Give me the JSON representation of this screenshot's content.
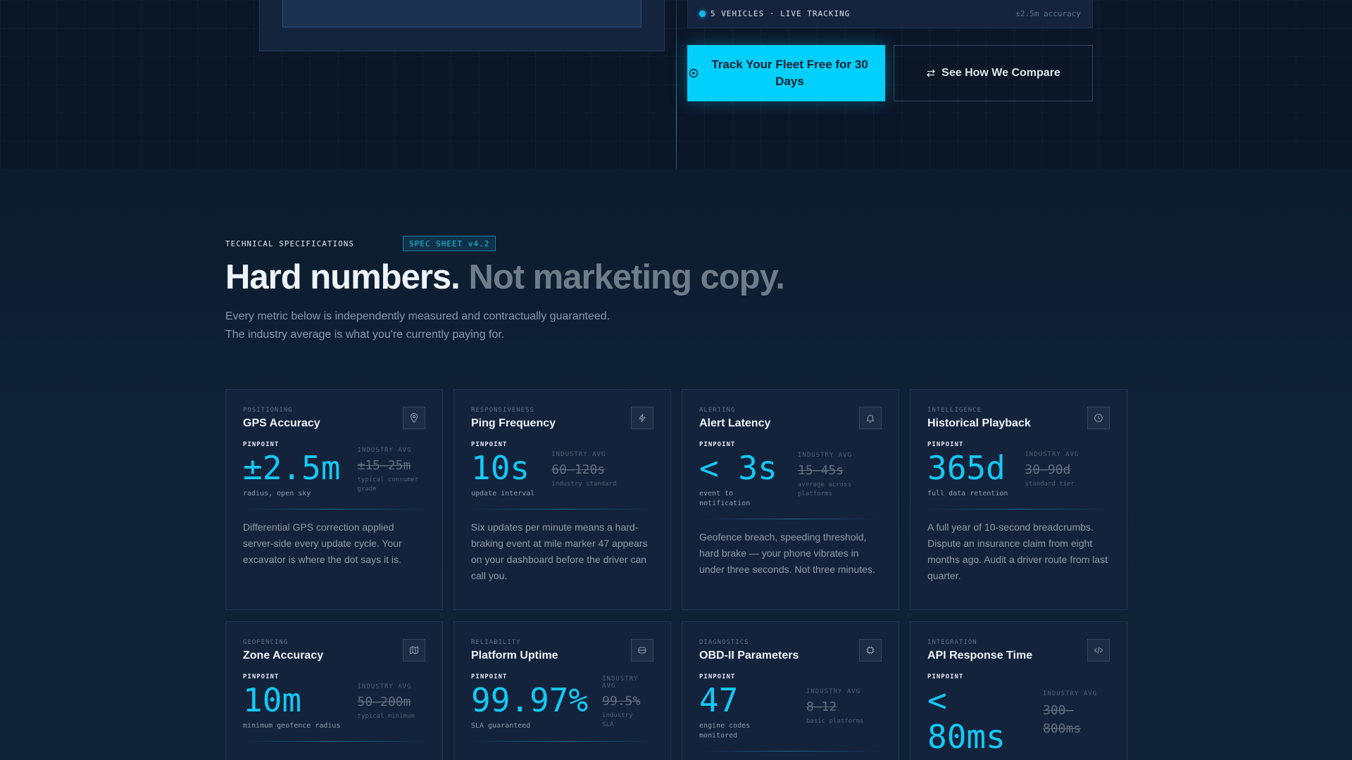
{
  "hero": {
    "tracking_label": "5 VEHICLES · LIVE TRACKING",
    "tracking_accuracy": "±2.5m accuracy",
    "primary_cta": "Track Your Fleet Free for 30 Days",
    "secondary_cta": "See How We Compare"
  },
  "specs": {
    "eyebrow": "TECHNICAL SPECIFICATIONS",
    "badge": "SPEC SHEET v4.2",
    "headline_strong": "Hard numbers.",
    "headline_muted": "Not marketing copy.",
    "subtext_line1": "Every metric below is independently measured and contractually guaranteed.",
    "subtext_line2": "The industry average is what you're currently paying for.",
    "pinpoint_label": "PINPOINT",
    "industry_label": "INDUSTRY AVG",
    "cards": [
      {
        "category": "POSITIONING",
        "title": "GPS Accuracy",
        "icon": "map-pin-icon",
        "value": "±2.5m",
        "caption": "radius, open sky",
        "industry_value": "±15–25m",
        "industry_caption": "typical consumer grade",
        "description": "Differential GPS correction applied server-side every update cycle. Your excavator is where the dot says it is."
      },
      {
        "category": "RESPONSIVENESS",
        "title": "Ping Frequency",
        "icon": "lightning-icon",
        "value": "10s",
        "caption": "update interval",
        "industry_value": "60–120s",
        "industry_caption": "industry standard",
        "description": "Six updates per minute means a hard-braking event at mile marker 47 appears on your dashboard before the driver can call you."
      },
      {
        "category": "ALERTING",
        "title": "Alert Latency",
        "icon": "bell-icon",
        "value": "< 3s",
        "caption": "event to notification",
        "industry_value": "15–45s",
        "industry_caption": "average across platforms",
        "description": "Geofence breach, speeding threshold, hard brake — your phone vibrates in under three seconds. Not three minutes."
      },
      {
        "category": "INTELLIGENCE",
        "title": "Historical Playback",
        "icon": "clock-icon",
        "value": "365d",
        "caption": "full data retention",
        "industry_value": "30–90d",
        "industry_caption": "standard tier",
        "description": "A full year of 10-second breadcrumbs. Dispute an insurance claim from eight months ago. Audit a driver route from last quarter."
      },
      {
        "category": "GEOFENCING",
        "title": "Zone Accuracy",
        "icon": "map-icon",
        "value": "10m",
        "caption": "minimum geofence radius",
        "industry_value": "50–200m",
        "industry_caption": "typical minimum",
        "description": ""
      },
      {
        "category": "RELIABILITY",
        "title": "Platform Uptime",
        "icon": "server-icon",
        "value": "99.97%",
        "caption": "SLA guaranteed",
        "industry_value": "99.5%",
        "industry_caption": "industry SLA",
        "description": ""
      },
      {
        "category": "DIAGNOSTICS",
        "title": "OBD-II Parameters",
        "icon": "chip-icon",
        "value": "47",
        "caption": "engine codes monitored",
        "industry_value": "8–12",
        "industry_caption": "basic platforms",
        "description": ""
      },
      {
        "category": "INTEGRATION",
        "title": "API Response Time",
        "icon": "code-icon",
        "value": "< 80ms",
        "caption": "",
        "industry_value": "300–800ms",
        "industry_caption": "",
        "description": ""
      }
    ]
  },
  "colors": {
    "accent": "#00d0fb",
    "background": "#0d1a2b",
    "card": "#14233c"
  }
}
